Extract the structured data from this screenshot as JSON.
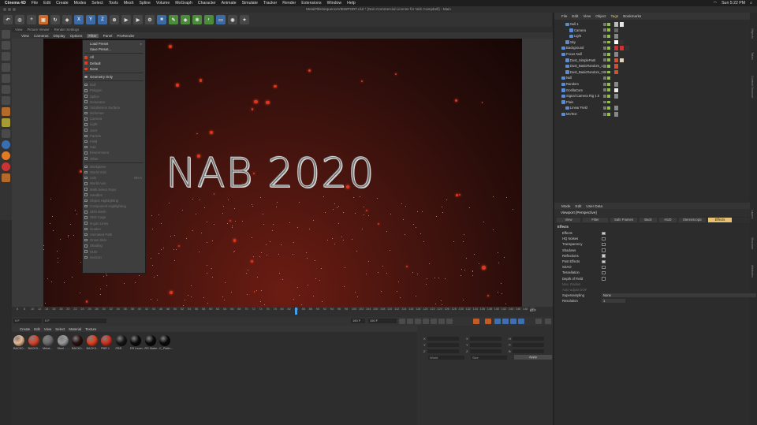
{
  "menubar": {
    "app": "Cinema 4D",
    "items": [
      "File",
      "Edit",
      "Create",
      "Modes",
      "Select",
      "Tools",
      "Mesh",
      "Spline",
      "Volume",
      "MoGraph",
      "Character",
      "Animate",
      "Simulate",
      "Tracker",
      "Render",
      "Extensions",
      "Window",
      "Help"
    ],
    "clock": "Sun 5:22 PM"
  },
  "window": {
    "title": "MetalTitleSequenceVIEWPORT.c4d * (Non-Commercial License for Nick Campbell) - Main"
  },
  "toolbar": {
    "xyz": [
      "X",
      "Y",
      "Z"
    ]
  },
  "viewport": {
    "tabs": [
      "View",
      "Picture Viewer",
      "Render Settings"
    ],
    "menu": [
      "View",
      "Cameras",
      "Display",
      "Options",
      "Filter",
      "Panel",
      "ProRender"
    ],
    "title_text": "NAB 2020"
  },
  "dropdown": {
    "items": [
      {
        "label": "Load Preset",
        "state": "none",
        "arrow": true
      },
      {
        "label": "Save Preset...",
        "state": "none"
      },
      {
        "sep": true
      },
      {
        "label": "All",
        "state": "red"
      },
      {
        "label": "Default",
        "state": "red"
      },
      {
        "label": "None",
        "state": "red"
      },
      {
        "sep": true
      },
      {
        "label": "Geometry Only",
        "state": "on"
      },
      {
        "sep": true
      },
      {
        "label": "Null",
        "dim": true
      },
      {
        "label": "Polygon",
        "dim": true
      },
      {
        "label": "Spline",
        "dim": true
      },
      {
        "label": "Generator",
        "dim": true
      },
      {
        "label": "Subdivision Surface",
        "dim": true
      },
      {
        "label": "Deformer",
        "dim": true
      },
      {
        "label": "Camera",
        "dim": true
      },
      {
        "label": "Light",
        "dim": true
      },
      {
        "label": "Joint",
        "dim": true
      },
      {
        "label": "Particle",
        "dim": true
      },
      {
        "label": "Field",
        "dim": true
      },
      {
        "label": "Hair",
        "dim": true
      },
      {
        "label": "Environment",
        "dim": true
      },
      {
        "label": "Other",
        "dim": true
      },
      {
        "sep": true
      },
      {
        "label": "Workplane",
        "dim": true
      },
      {
        "label": "World Grid",
        "dim": true
      },
      {
        "label": "Axis",
        "dim": true,
        "shortcut": "Alt+A"
      },
      {
        "label": "World Axis",
        "dim": true
      },
      {
        "label": "Multi Select Rays",
        "dim": true
      },
      {
        "label": "Handles",
        "dim": true
      },
      {
        "label": "Object Highlighting",
        "dim": true
      },
      {
        "label": "Component Highlighting",
        "dim": true
      },
      {
        "label": "SDS Mesh",
        "dim": true
      },
      {
        "label": "SDS Cage",
        "dim": true
      },
      {
        "label": "N-gon Lines",
        "dim": true
      },
      {
        "label": "Guides",
        "dim": true
      },
      {
        "label": "Animated Path",
        "dim": true
      },
      {
        "label": "Onion Skin",
        "dim": true
      },
      {
        "label": "Shading",
        "dim": true
      },
      {
        "label": "HUD",
        "dim": true
      },
      {
        "label": "Horizon",
        "dim": true
      }
    ]
  },
  "timeline": {
    "ticks": [
      "6",
      "8",
      "10",
      "12",
      "14",
      "16",
      "18",
      "20",
      "22",
      "24",
      "26",
      "28",
      "30",
      "32",
      "34",
      "36",
      "38",
      "40",
      "42",
      "44",
      "46",
      "48",
      "50",
      "52",
      "54",
      "56",
      "58",
      "60",
      "62",
      "64",
      "66",
      "68",
      "70",
      "72",
      "74",
      "76",
      "78",
      "80",
      "82",
      "84",
      "86",
      "88",
      "90",
      "92",
      "94",
      "96",
      "98",
      "100",
      "102",
      "104",
      "106",
      "108",
      "110",
      "112",
      "114",
      "116",
      "118",
      "120",
      "122",
      "124",
      "126",
      "128",
      "130",
      "132",
      "134",
      "136",
      "138",
      "140",
      "142",
      "144",
      "146",
      "148",
      "150"
    ],
    "end_frame": "83 F",
    "start_field": "0 F",
    "min_field": "0 F",
    "max_field": "150 F",
    "max_field2": "150 F"
  },
  "materials": {
    "menu": [
      "Create",
      "Edit",
      "View",
      "Select",
      "Material",
      "Texture"
    ],
    "items": [
      {
        "label": "BACK0...",
        "color": "#e8b890"
      },
      {
        "label": "BACK0...",
        "color": "#d8432a"
      },
      {
        "label": "Metal...",
        "color": "#6a6a6a"
      },
      {
        "label": "Steel - ...",
        "color": "#9a9a9a"
      },
      {
        "label": "BACK0...",
        "color": "#2a1010"
      },
      {
        "label": "BACK0...",
        "color": "#e04020"
      },
      {
        "label": "PBR 1",
        "color": "#d03020"
      },
      {
        "label": "PBR",
        "color": "#151515"
      },
      {
        "label": "RS Incan...",
        "color": "#0a0a0a"
      },
      {
        "label": "RS Mater...",
        "color": "#0a0a0a"
      },
      {
        "label": "C_Platin...",
        "color": "#0a0a0a"
      }
    ]
  },
  "coords": {
    "labels": [
      "X",
      "Y",
      "Z",
      "X",
      "Y",
      "Z",
      "H",
      "P",
      "B"
    ],
    "selects": [
      "World",
      "Size"
    ],
    "apply": "Apply"
  },
  "object_manager": {
    "menu": [
      "File",
      "Edit",
      "View",
      "Object",
      "Tags",
      "Bookmarks"
    ],
    "highlight": "Tags",
    "objects": [
      {
        "name": "Null.1",
        "indent": 2
      },
      {
        "name": "Camera",
        "indent": 3
      },
      {
        "name": "Light",
        "indent": 3
      },
      {
        "name": "Sky",
        "indent": 2
      },
      {
        "name": "Background",
        "indent": 1
      },
      {
        "name": "Focus Null",
        "indent": 1
      },
      {
        "name": "Dust_SimpleParti",
        "indent": 2
      },
      {
        "name": "Dust_BasicRandom_1",
        "indent": 2
      },
      {
        "name": "Dust_BasicRandom_2",
        "indent": 2
      },
      {
        "name": "Null",
        "indent": 1
      },
      {
        "name": "Random",
        "indent": 1
      },
      {
        "name": "GorillaCam",
        "indent": 1
      },
      {
        "name": "Signal Camera Rig 1.0",
        "indent": 1
      },
      {
        "name": "Plain",
        "indent": 1
      },
      {
        "name": "Linear Field",
        "indent": 2
      },
      {
        "name": "MoText",
        "indent": 1
      }
    ]
  },
  "attributes": {
    "menu": [
      "Mode",
      "Edit",
      "User Data"
    ],
    "title": "Viewport [Perspective]",
    "tabs": [
      "View",
      "Filter",
      "Safe Frames",
      "Back",
      "HUD",
      "Stereoscopic",
      "Effects"
    ],
    "active_tab": "Effects",
    "section": "Effects",
    "rows": [
      {
        "label": "Effects",
        "check": true
      },
      {
        "label": "HQ Noises",
        "check": false
      },
      {
        "label": "Transparency",
        "check": false
      },
      {
        "label": "Shadows",
        "check": false
      },
      {
        "label": "Reflections",
        "check": true
      },
      {
        "label": "Post Effects",
        "check": true
      },
      {
        "label": "SSAO",
        "check": false
      },
      {
        "label": "Tessellation",
        "check": false
      },
      {
        "label": "Depth of Field",
        "check": false
      },
      {
        "label": "Max. Radius",
        "dim": true
      },
      {
        "label": "Auto-adjust DOF",
        "dim": true
      },
      {
        "label": "Supersampling",
        "select": "None"
      },
      {
        "label": "Resolution",
        "value": "1"
      }
    ]
  },
  "side_tabs": [
    "Objects",
    "Takes",
    "Content Browser",
    "Layers",
    "Structure",
    "Attributes"
  ],
  "layout": "Layout:",
  "colors": {
    "accent": "#e8c273",
    "brand": "#c96b2b",
    "viewport_bg": "#3a120d"
  }
}
